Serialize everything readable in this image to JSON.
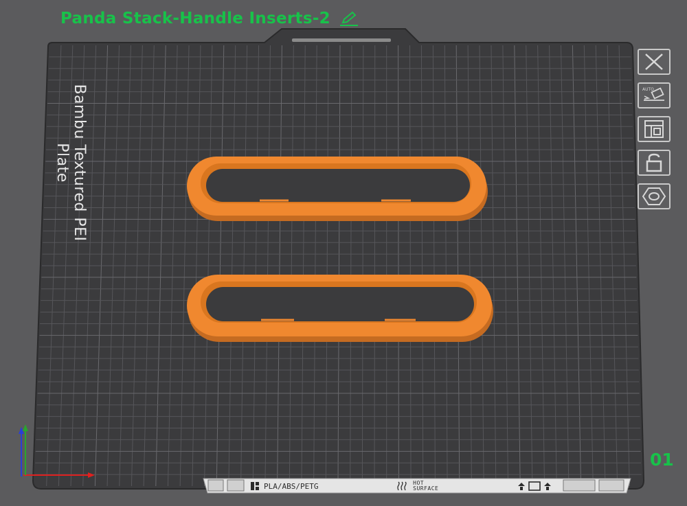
{
  "project": {
    "title": "Panda Stack-Handle Inserts-2"
  },
  "plate": {
    "name": "Bambu Textured PEI Plate",
    "number": "01",
    "materials": "PLA/ABS/PETG",
    "warning_line1": "HOT",
    "warning_line2": "SURFACE"
  },
  "toolbar": {
    "items": [
      {
        "label": "close",
        "icon": "close-icon"
      },
      {
        "label": "auto-orient",
        "icon": "auto-orient-icon"
      },
      {
        "label": "arrange",
        "icon": "arrange-icon"
      },
      {
        "label": "lock",
        "icon": "lock-icon"
      },
      {
        "label": "plate-settings",
        "icon": "hexagon-icon"
      }
    ]
  },
  "colors": {
    "background": "#5b5b5d",
    "plate": "#3b3b3d",
    "grid": "#56565a",
    "accent_green": "#18c24a",
    "part_orange": "#f0882f",
    "axis_x": "#e0201f",
    "axis_y": "#2aa52e",
    "axis_z": "#2a3fd6"
  }
}
